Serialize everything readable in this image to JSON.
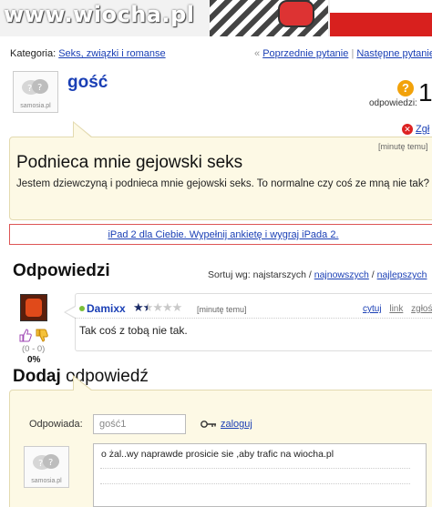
{
  "banner": {
    "watermark": "www.wiocha.pl"
  },
  "category": {
    "label": "Kategoria:",
    "value": "Seks, związki i romanse",
    "prev_marker": "«",
    "prev": "Poprzednie pytanie",
    "separator": "|",
    "next": "Następne pytanie"
  },
  "asker": {
    "name": "gość",
    "avatar_label": "samosia.pl",
    "answers_label": "odpowiedzi:",
    "answers_count": "1",
    "report": "Zgł"
  },
  "question": {
    "time": "[minutę temu]",
    "title": "Podnieca mnie gejowski seks",
    "body": "Jestem dziewczyną i podnieca mnie gejowski seks. To normalne czy coś ze mną nie tak?"
  },
  "ad": {
    "text": "iPad 2 dla Ciebie. Wypełnij ankietę i wygraj iPada 2."
  },
  "answers": {
    "heading": "Odpowiedzi",
    "sort_label": "Sortuj wg:",
    "sort_oldest": "najstarszych",
    "sort_newest": "najnowszych",
    "sort_best": "najlepszych",
    "sort_sep": "/",
    "items": [
      {
        "user": "Damixx",
        "rating": 1.5,
        "time": "[minutę temu]",
        "quote": "cytuj",
        "link": "link",
        "report": "zgłoś",
        "text": "Tak coś z tobą nie tak.",
        "votes": "(0 - 0)",
        "percent": "0%"
      }
    ]
  },
  "add_answer": {
    "heading_bold": "Dodaj",
    "heading_rest": "odpowiedź",
    "responder_label": "Odpowiada:",
    "responder_value": "gość1",
    "login": "zaloguj",
    "avatar_label": "samosia.pl",
    "answer_text": "o żal..wy naprawde prosicie sie ,aby trafic na wiocha.pl"
  },
  "colors": {
    "link": "#1a3fb5",
    "bubble_bg": "#fdf9e5",
    "bubble_border": "#e3dab0",
    "ad_border": "#d55555",
    "question_icon": "#f2a20a"
  }
}
